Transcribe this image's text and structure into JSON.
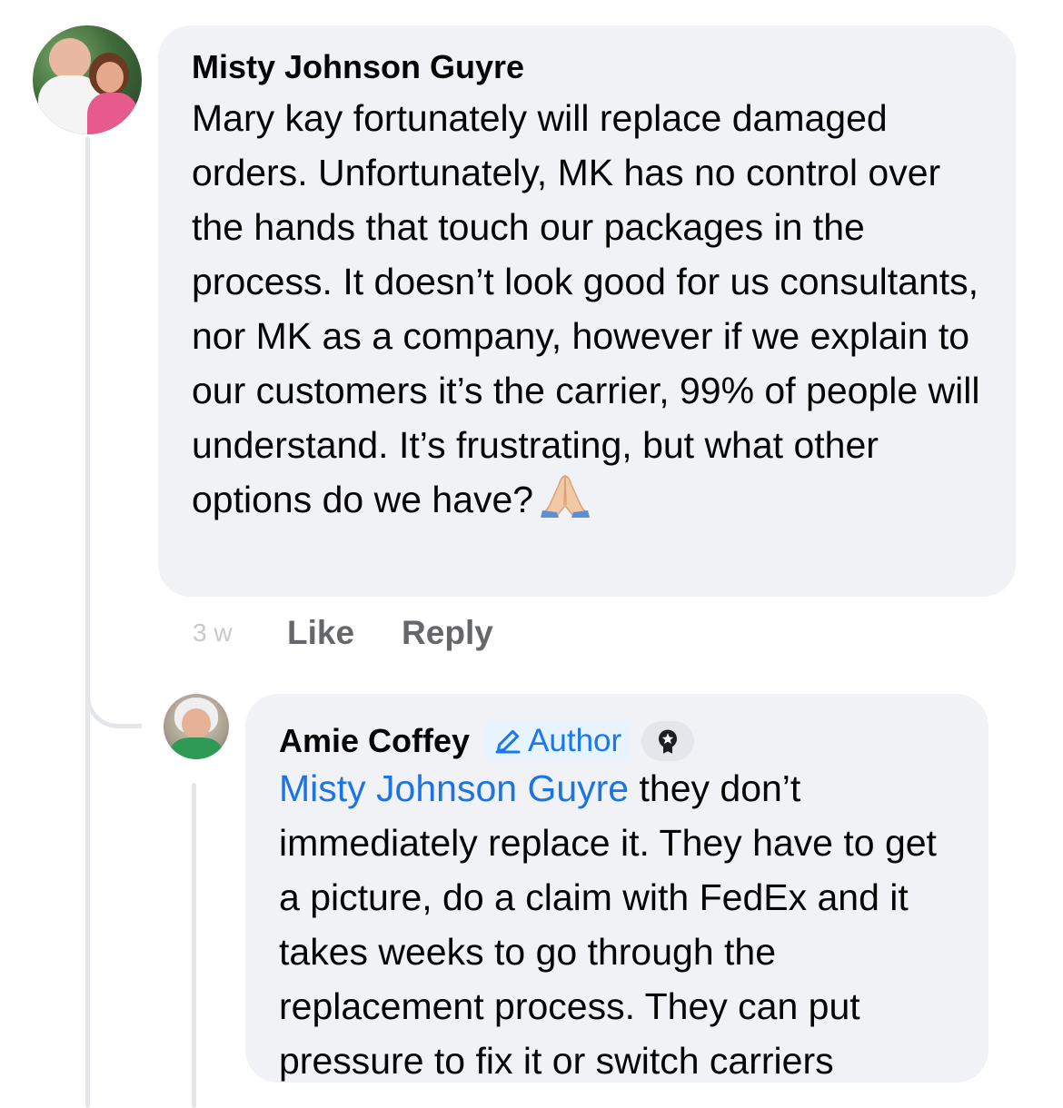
{
  "comments": [
    {
      "author": "Misty Johnson Guyre",
      "text": "Mary kay fortunately will replace damaged orders. Unfortunately, MK has no control over the hands that touch our packages in the process. It doesn’t look good for us consultants, nor MK as a company, however if we explain to our customers it’s the carrier, 99% of people will understand. It’s frustrating, but what other options do we have?",
      "emoji": "folded-hands",
      "time": "3 w",
      "actions": {
        "like": "Like",
        "reply": "Reply"
      }
    },
    {
      "author": "Amie Coffey",
      "badge": "Author",
      "mention": "Misty Johnson Guyre",
      "text": " they don’t immediately replace it. They have to get a picture, do a claim with FedEx and it takes weeks to go through the replacement process. They can put pressure to fix it or switch carriers"
    }
  ],
  "colors": {
    "bubble": "#f0f2f5",
    "link": "#1b74e4",
    "secondary_text": "#65676b",
    "thread_line": "#e4e6eb"
  }
}
